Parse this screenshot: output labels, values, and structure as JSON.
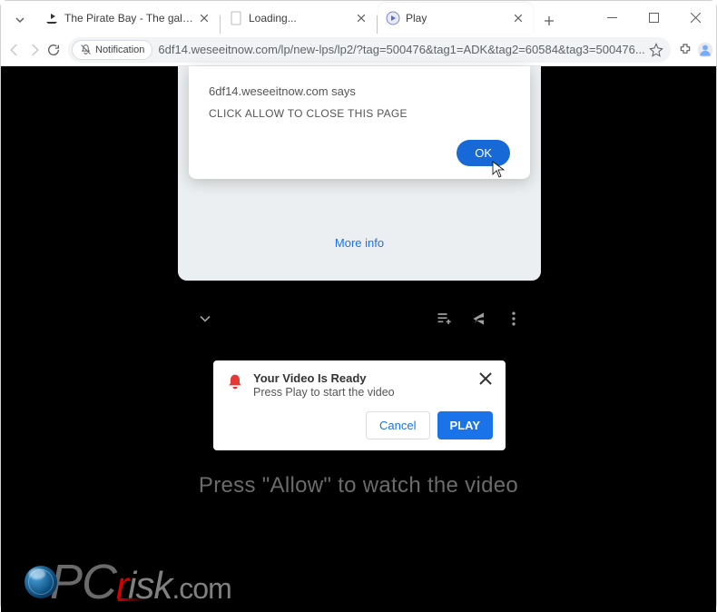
{
  "window": {
    "tabs": [
      {
        "title": "The Pirate Bay - The galaxy's m",
        "favicon": "pirate"
      },
      {
        "title": "Loading...",
        "favicon": "blank"
      },
      {
        "title": "Play",
        "favicon": "play"
      }
    ]
  },
  "toolbar": {
    "notification_chip": "Notification",
    "url": "6df14.weseeitnow.com/lp/new-lps/lp2/?tag=500476&tag1=ADK&tag2=60584&tag3=500476..."
  },
  "alert": {
    "title": "6df14.weseeitnow.com says",
    "body": "CLICK ALLOW TO CLOSE THIS PAGE",
    "ok": "OK"
  },
  "card": {
    "more_info": "More info"
  },
  "video_dialog": {
    "title": "Your Video Is Ready",
    "subtitle": "Press Play to start the video",
    "cancel": "Cancel",
    "play": "PLAY"
  },
  "prompt": "Press \"Allow\" to watch the video",
  "watermark": {
    "p": "P",
    "c": "C",
    "r": "r",
    "rest": "isk",
    "domain": ".com"
  }
}
